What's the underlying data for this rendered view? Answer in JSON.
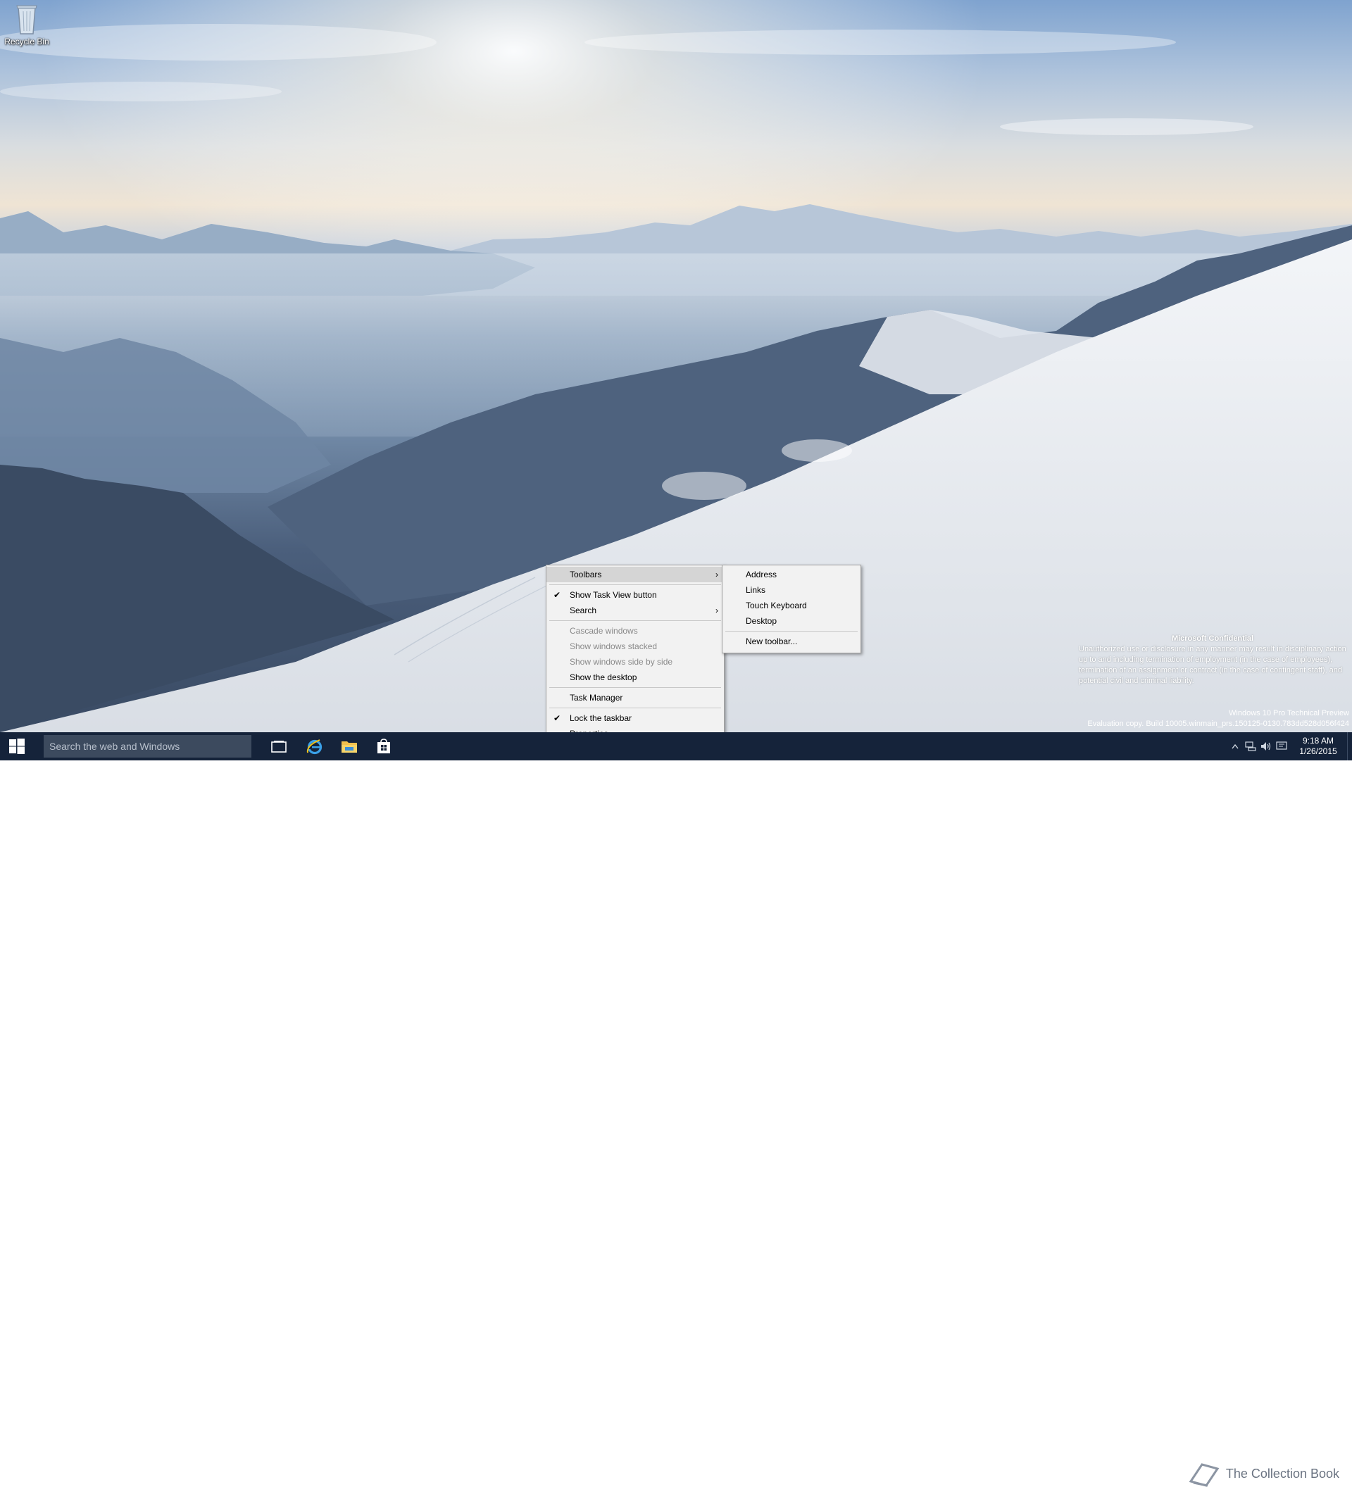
{
  "desktop": {
    "icons": [
      {
        "label": "Recycle Bin",
        "icon": "recycle-bin-icon"
      }
    ]
  },
  "watermark": {
    "confidential_title": "Microsoft Confidential",
    "confidential_text": "Unauthorized use or disclosure in any manner may result in disciplinary action up to and including termination of employment (in the case of employees), termination of an assignment or contract (in the case of contingent staff), and potential civil and criminal liability.",
    "edition": "Windows 10 Pro Technical Preview",
    "build": "Evaluation copy. Build 10005.winmain_prs.150125-0130.783dd528d056f424",
    "site": "The Collection Book"
  },
  "context_menu": {
    "items": [
      {
        "label": "Toolbars",
        "checked": false,
        "disabled": false,
        "submenu": true,
        "highlighted": true
      },
      {
        "separator": true
      },
      {
        "label": "Show Task View button",
        "checked": true,
        "disabled": false,
        "submenu": false
      },
      {
        "label": "Search",
        "checked": false,
        "disabled": false,
        "submenu": true
      },
      {
        "separator": true
      },
      {
        "label": "Cascade windows",
        "checked": false,
        "disabled": true,
        "submenu": false
      },
      {
        "label": "Show windows stacked",
        "checked": false,
        "disabled": true,
        "submenu": false
      },
      {
        "label": "Show windows side by side",
        "checked": false,
        "disabled": true,
        "submenu": false
      },
      {
        "label": "Show the desktop",
        "checked": false,
        "disabled": false,
        "submenu": false
      },
      {
        "separator": true
      },
      {
        "label": "Task Manager",
        "checked": false,
        "disabled": false,
        "submenu": false
      },
      {
        "separator": true
      },
      {
        "label": "Lock the taskbar",
        "checked": true,
        "disabled": false,
        "submenu": false
      },
      {
        "label": "Properties",
        "checked": false,
        "disabled": false,
        "submenu": false
      }
    ],
    "check_glyph": "✔",
    "arrow_glyph": "›"
  },
  "toolbars_submenu": {
    "items": [
      {
        "label": "Address"
      },
      {
        "label": "Links"
      },
      {
        "label": "Touch Keyboard"
      },
      {
        "label": "Desktop"
      },
      {
        "separator": true
      },
      {
        "label": "New toolbar..."
      }
    ]
  },
  "taskbar": {
    "search_placeholder": "Search the web and Windows",
    "pinned": [
      {
        "name": "task-view-icon"
      },
      {
        "name": "internet-explorer-icon"
      },
      {
        "name": "file-explorer-icon"
      },
      {
        "name": "store-icon"
      }
    ],
    "tray_icons": [
      "chevron-up-icon",
      "network-icon",
      "volume-icon",
      "action-center-icon"
    ],
    "clock": {
      "time": "9:18 AM",
      "date": "1/26/2015"
    }
  },
  "colors": {
    "taskbar": "#15233a",
    "search_box": "#3c4a5e",
    "menu_bg": "#f2f2f2",
    "menu_highlight": "#d5d5d5"
  }
}
